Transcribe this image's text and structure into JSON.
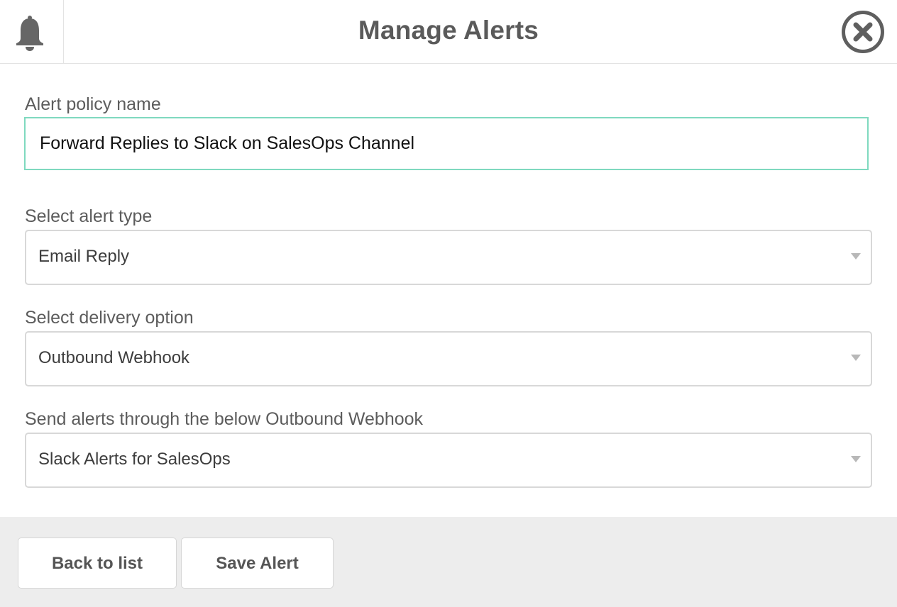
{
  "header": {
    "title": "Manage Alerts",
    "left_icon": "bell-icon",
    "close_icon": "close-circle-icon"
  },
  "form": {
    "policy_name": {
      "label": "Alert policy name",
      "value": "Forward Replies to Slack on SalesOps Channel"
    },
    "alert_type": {
      "label": "Select alert type",
      "selected": "Email Reply"
    },
    "delivery_option": {
      "label": "Select delivery option",
      "selected": "Outbound Webhook"
    },
    "webhook": {
      "label": "Send alerts through the below Outbound Webhook",
      "selected": "Slack Alerts for SalesOps"
    }
  },
  "footer": {
    "back_label": "Back to list",
    "save_label": "Save Alert"
  },
  "colors": {
    "accent_focus_border": "#7fd9bf",
    "footer_bg": "#ededed",
    "text": "#555555"
  }
}
